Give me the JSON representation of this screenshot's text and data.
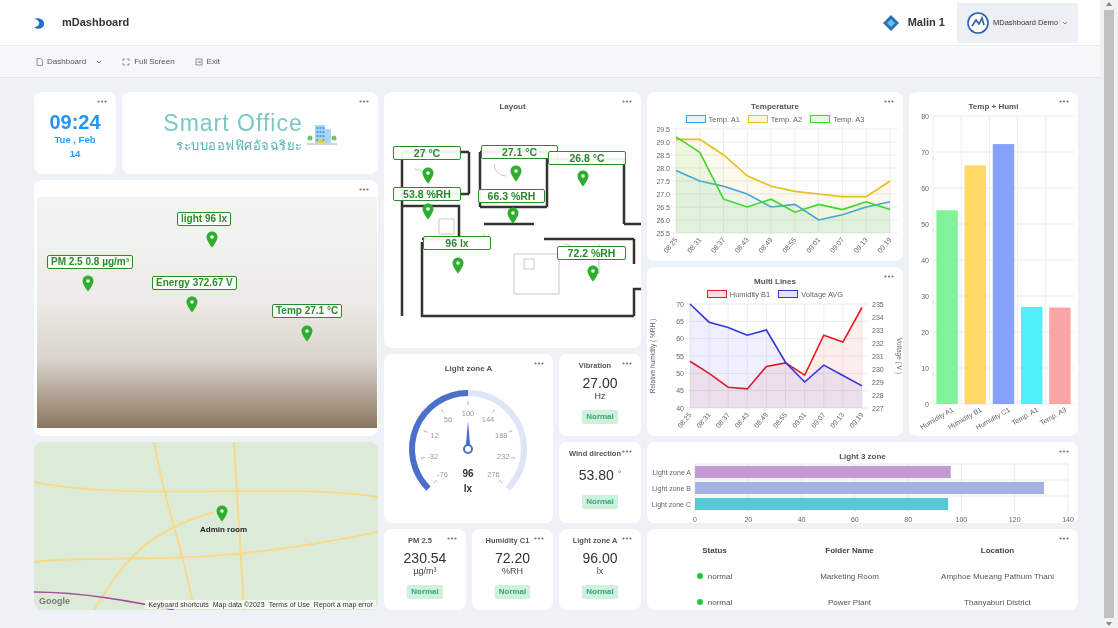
{
  "header": {
    "brand": "mDashboard",
    "site": "Malin 1",
    "user": "MDashboard Demo"
  },
  "toolbar": [
    {
      "label": "Dashboard",
      "kind": "dropdown"
    },
    {
      "label": "Full Screen",
      "kind": "fullscreen"
    },
    {
      "label": "Exit",
      "kind": "exit"
    }
  ],
  "clock": {
    "time": "09:24",
    "date": "Tue , Feb",
    "day": "14"
  },
  "banner": {
    "title": "Smart Office",
    "subtitle": "ระบบออฟฟิศอัจฉริยะ"
  },
  "photo": {
    "markers": [
      {
        "label": "light 96 lx"
      },
      {
        "label": "PM 2.5 0.8  µg/m³"
      },
      {
        "label": "Energy 372.67 V"
      },
      {
        "label": "Temp 27.1 °C"
      }
    ]
  },
  "map": {
    "marker": "Admin room",
    "logo": "Google",
    "attribution": [
      "Keyboard shortcuts",
      "Map data ©2023",
      "Terms of Use",
      "Report a map error"
    ]
  },
  "layout": {
    "title": "Layout",
    "labels": [
      "27 °C",
      "27.1 °C",
      "26.8 °C",
      "53.8 %RH",
      "66.3 %RH",
      "96 lx",
      "72.2 %RH"
    ]
  },
  "gauge": {
    "title": "Light zone A",
    "ticks": [
      "-76",
      "-32",
      "12",
      "56",
      "100",
      "144",
      "188",
      "232",
      "276"
    ],
    "value": "96",
    "unit": "lx",
    "level": 0.5
  },
  "stats": [
    {
      "title": "Vibration",
      "value": "27.00",
      "unit": "Hz",
      "kind": "stacked",
      "status": "Normal"
    },
    {
      "title": "Wind direction",
      "value": "53.80",
      "unit": "°",
      "kind": "inline",
      "status": "Normal"
    },
    {
      "title": "PM 2.5",
      "value": "230.54",
      "unit": "µg/m³",
      "kind": "stacked",
      "status": "Normal"
    },
    {
      "title": "Humidity C1",
      "value": "72.20",
      "unit": "%RH",
      "kind": "stacked",
      "status": "Normal"
    },
    {
      "title": "Light zone A",
      "value": "96.00",
      "unit": "lx",
      "kind": "stacked",
      "status": "Normal"
    }
  ],
  "temperature": {
    "chart_data": {
      "type": "area",
      "grid": true,
      "title": "Temperature",
      "categories": [
        "08:25",
        "08:31",
        "08:37",
        "08:43",
        "08:49",
        "08:55",
        "09:01",
        "09:07",
        "09:13",
        "09:19"
      ],
      "ylim": [
        25.5,
        29.5
      ],
      "yticks": [
        25.5,
        {
          "value": 26,
          "label": "26.0"
        },
        26.5,
        {
          "value": 27,
          "label": "27.0"
        },
        27.5,
        {
          "value": 28,
          "label": "28.0"
        },
        28.5,
        {
          "value": 29,
          "label": "29.0"
        },
        29.5
      ],
      "series": [
        {
          "name": "Temp. A1",
          "color": "#36a2eb",
          "values": [
            27.9,
            27.5,
            27.3,
            27.0,
            26.5,
            26.6,
            26.0,
            26.2,
            26.5,
            26.7
          ]
        },
        {
          "name": "Temp. A2",
          "color": "#e6c01a",
          "values": [
            29.1,
            29.1,
            28.5,
            27.7,
            27.3,
            27.1,
            27.0,
            26.9,
            26.9,
            27.5
          ]
        },
        {
          "name": "Temp. A3",
          "color": "#3fd62e",
          "values": [
            29.2,
            28.6,
            26.8,
            26.5,
            26.8,
            26.3,
            26.6,
            26.4,
            26.7,
            26.4
          ]
        }
      ]
    }
  },
  "temp_humi": {
    "chart_data": {
      "type": "bar",
      "grid": true,
      "title": "Temp + Humi",
      "categories": [
        "Humidity A1",
        "Humidity B1",
        "Humidity C1",
        "Temp. A1",
        "Temp. A3"
      ],
      "ylim": [
        0,
        80
      ],
      "yticks": [
        0,
        10,
        20,
        30,
        40,
        50,
        60,
        70,
        80
      ],
      "series": [
        {
          "colors": [
            "#7ff29a",
            "#ffd966",
            "#87a3f9",
            "#4ff0f7",
            "#f9a5a5"
          ],
          "values": [
            53.8,
            66.3,
            72.2,
            27,
            26.8
          ]
        }
      ]
    }
  },
  "multi_lines": {
    "chart_data": {
      "type": "area",
      "grid": true,
      "title": "Multi Lines",
      "categories": [
        "08:25",
        "08:31",
        "08:37",
        "08:43",
        "08:49",
        "08:55",
        "09:01",
        "09:07",
        "09:13",
        "09:19"
      ],
      "ylabel": "Relative humidity ( %RH )",
      "y2label": "Voltage ( V )",
      "ylim": [
        40,
        70
      ],
      "yticks": [
        40,
        45,
        50,
        55,
        60,
        65,
        70
      ],
      "y2lim": [
        227,
        235
      ],
      "y2ticks": [
        227,
        228,
        229,
        230,
        231,
        232,
        233,
        234,
        235
      ],
      "series": [
        {
          "name": "Humidity B1",
          "color": "#e8191f",
          "values": [
            53.5,
            50,
            46,
            45.5,
            52,
            53,
            49.5,
            61,
            59,
            69
          ]
        },
        {
          "name": "Voltage AVG",
          "color": "#3535e0",
          "axis": "y2",
          "values": [
            235,
            233.6,
            233.2,
            232.6,
            233,
            230.5,
            229,
            230.3,
            229.5,
            228.7
          ]
        }
      ]
    }
  },
  "light_zones": {
    "chart_data": {
      "type": "bar",
      "grid": true,
      "orientation": "horizontal",
      "title": "Light 3 zone",
      "categories": [
        "Light zone A",
        "Light zone B",
        "Light zone C"
      ],
      "xlim": [
        0,
        140
      ],
      "xticks": [
        0,
        20,
        40,
        60,
        80,
        100,
        120,
        140
      ],
      "series": [
        {
          "colors": [
            "#c39bd3",
            "#a3b1e5",
            "#56c9d4"
          ],
          "values": [
            96,
            131,
            95
          ]
        }
      ]
    }
  },
  "table": {
    "columns": [
      "Status",
      "Folder Name",
      "Location"
    ],
    "rows": [
      {
        "status": "normal",
        "color": "#22c93a",
        "folder": "Marketing Room",
        "location": "Amphoe Mueang Pathum Thani"
      },
      {
        "status": "normal",
        "color": "#22c93a",
        "folder": "Power Plant",
        "location": "Thanyaburi District"
      }
    ]
  }
}
